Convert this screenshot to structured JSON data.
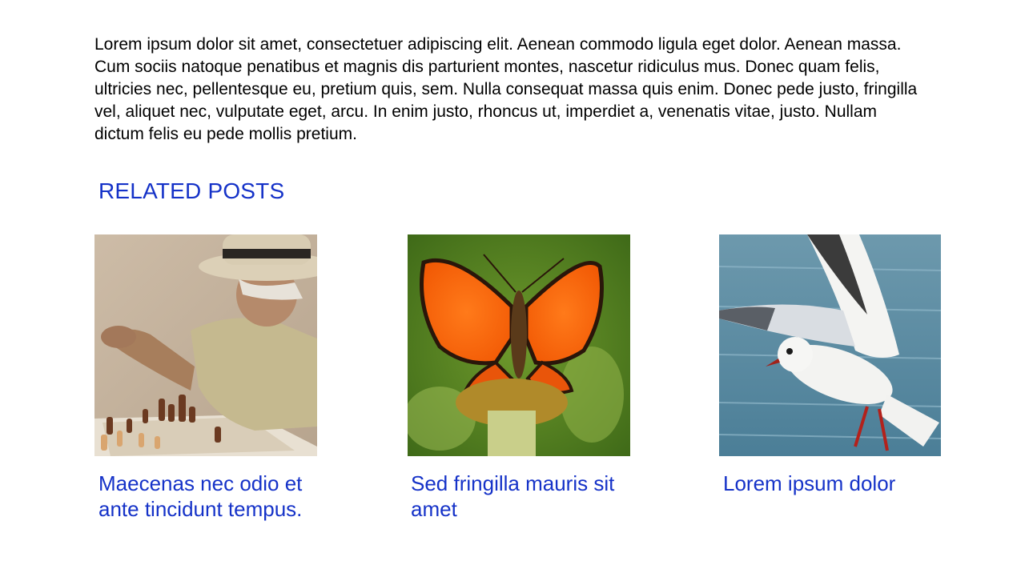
{
  "article": {
    "body": "Lorem ipsum dolor sit amet, consectetuer adipiscing elit. Aenean commodo ligula eget dolor. Aenean massa. Cum sociis natoque penatibus et magnis dis parturient montes, nascetur ridiculus mus. Donec quam felis, ultricies nec, pellentesque eu, pretium quis, sem. Nulla consequat massa quis enim. Donec pede justo, fringilla vel, aliquet nec, vulputate eget, arcu. In enim justo, rhoncus ut, imperdiet a, venenatis vitae, justo. Nullam dictum felis eu pede mollis pretium."
  },
  "related": {
    "heading": "RELATED POSTS",
    "posts": [
      {
        "title": "Maecenas nec odio et ante tincidunt tempus.",
        "image": "chess-player-photo"
      },
      {
        "title": "Sed fringilla mauris sit amet",
        "image": "orange-butterfly-photo"
      },
      {
        "title": "Lorem ipsum dolor",
        "image": "seagull-photo"
      }
    ]
  },
  "colors": {
    "link": "#1532c8",
    "text": "#000000",
    "background": "#ffffff"
  }
}
